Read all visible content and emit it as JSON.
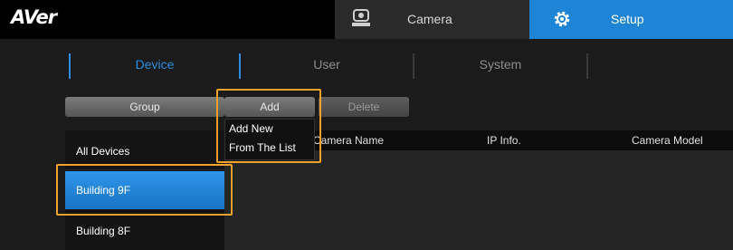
{
  "app": {
    "logo": "AVer"
  },
  "topbar": {
    "tabs": [
      {
        "label": "Camera",
        "icon": "camera-icon"
      },
      {
        "label": "Setup",
        "icon": "gear-icon"
      }
    ]
  },
  "subtabs": [
    "Device",
    "User",
    "System"
  ],
  "actions": {
    "group": "Group",
    "add": "Add",
    "delete": "Delete"
  },
  "add_menu": [
    "Add New",
    "From The List"
  ],
  "device_list": [
    "All Devices",
    "Building 9F",
    "Building 8F"
  ],
  "table": {
    "columns": [
      "Camera Name",
      "IP Info.",
      "Camera Model"
    ]
  },
  "colors": {
    "accent": "#1d84d6",
    "highlight": "#f0a22a"
  }
}
